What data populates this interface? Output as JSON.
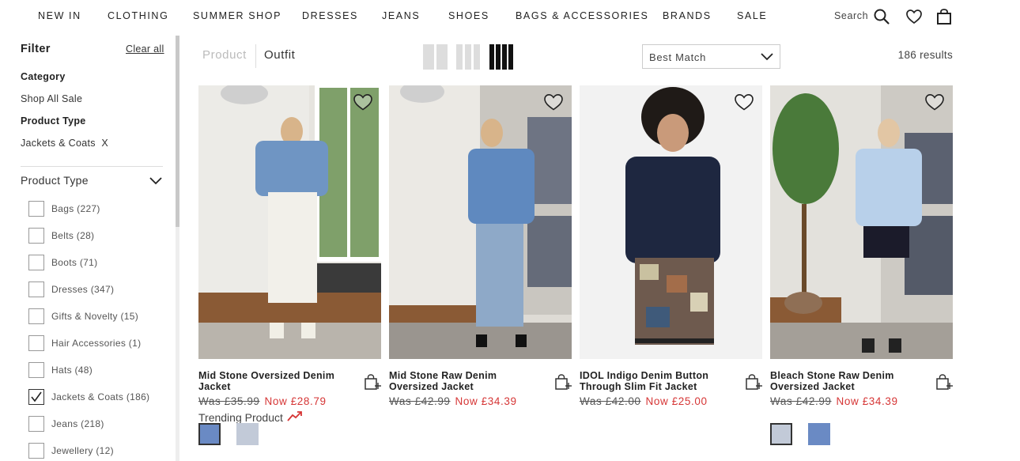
{
  "nav": {
    "items": [
      "NEW IN",
      "CLOTHING",
      "SUMMER SHOP",
      "DRESSES",
      "JEANS",
      "SHOES",
      "BAGS & ACCESSORIES",
      "BRANDS",
      "SALE"
    ],
    "search_label": "Search"
  },
  "filter": {
    "title": "Filter",
    "clear_all": "Clear all",
    "category_label": "Category",
    "category_value": "Shop All Sale",
    "product_type_label": "Product Type",
    "product_type_value": "Jackets & Coats  X",
    "section_title": "Product Type",
    "options": [
      {
        "label": "Bags (227)",
        "checked": false
      },
      {
        "label": "Belts (28)",
        "checked": false
      },
      {
        "label": "Boots (71)",
        "checked": false
      },
      {
        "label": "Dresses (347)",
        "checked": false
      },
      {
        "label": "Gifts & Novelty (15)",
        "checked": false
      },
      {
        "label": "Hair Accessories (1)",
        "checked": false
      },
      {
        "label": "Hats (48)",
        "checked": false
      },
      {
        "label": "Jackets & Coats (186)",
        "checked": true
      },
      {
        "label": "Jeans (218)",
        "checked": false
      },
      {
        "label": "Jewellery (12)",
        "checked": false
      }
    ]
  },
  "toolbar": {
    "tab_product": "Product",
    "tab_outfit": "Outfit",
    "sort_value": "Best Match",
    "results": "186 results"
  },
  "products": [
    {
      "name": "Mid Stone Oversized Denim Jacket",
      "was": "Was £35.99",
      "now": "Now £28.79",
      "trending": "Trending Product",
      "swatches": [
        "#6a8ac4",
        "#c2cad8"
      ]
    },
    {
      "name": "Mid Stone Raw Denim Oversized Jacket",
      "was": "Was £42.99",
      "now": "Now £34.39",
      "trending": "",
      "swatches": []
    },
    {
      "name": "IDOL Indigo Denim Button Through Slim Fit Jacket",
      "was": "Was £42.00",
      "now": "Now £25.00",
      "trending": "",
      "swatches": []
    },
    {
      "name": "Bleach Stone Raw Denim Oversized Jacket",
      "was": "Was £42.99",
      "now": "Now £34.39",
      "trending": "",
      "swatches": [
        "#c2cad8",
        "#6a8ac4"
      ]
    }
  ],
  "colors": {
    "sale_price": "#d63636",
    "swatch_mid_blue": "#6a8ac4",
    "swatch_light_blue": "#c2cad8"
  }
}
